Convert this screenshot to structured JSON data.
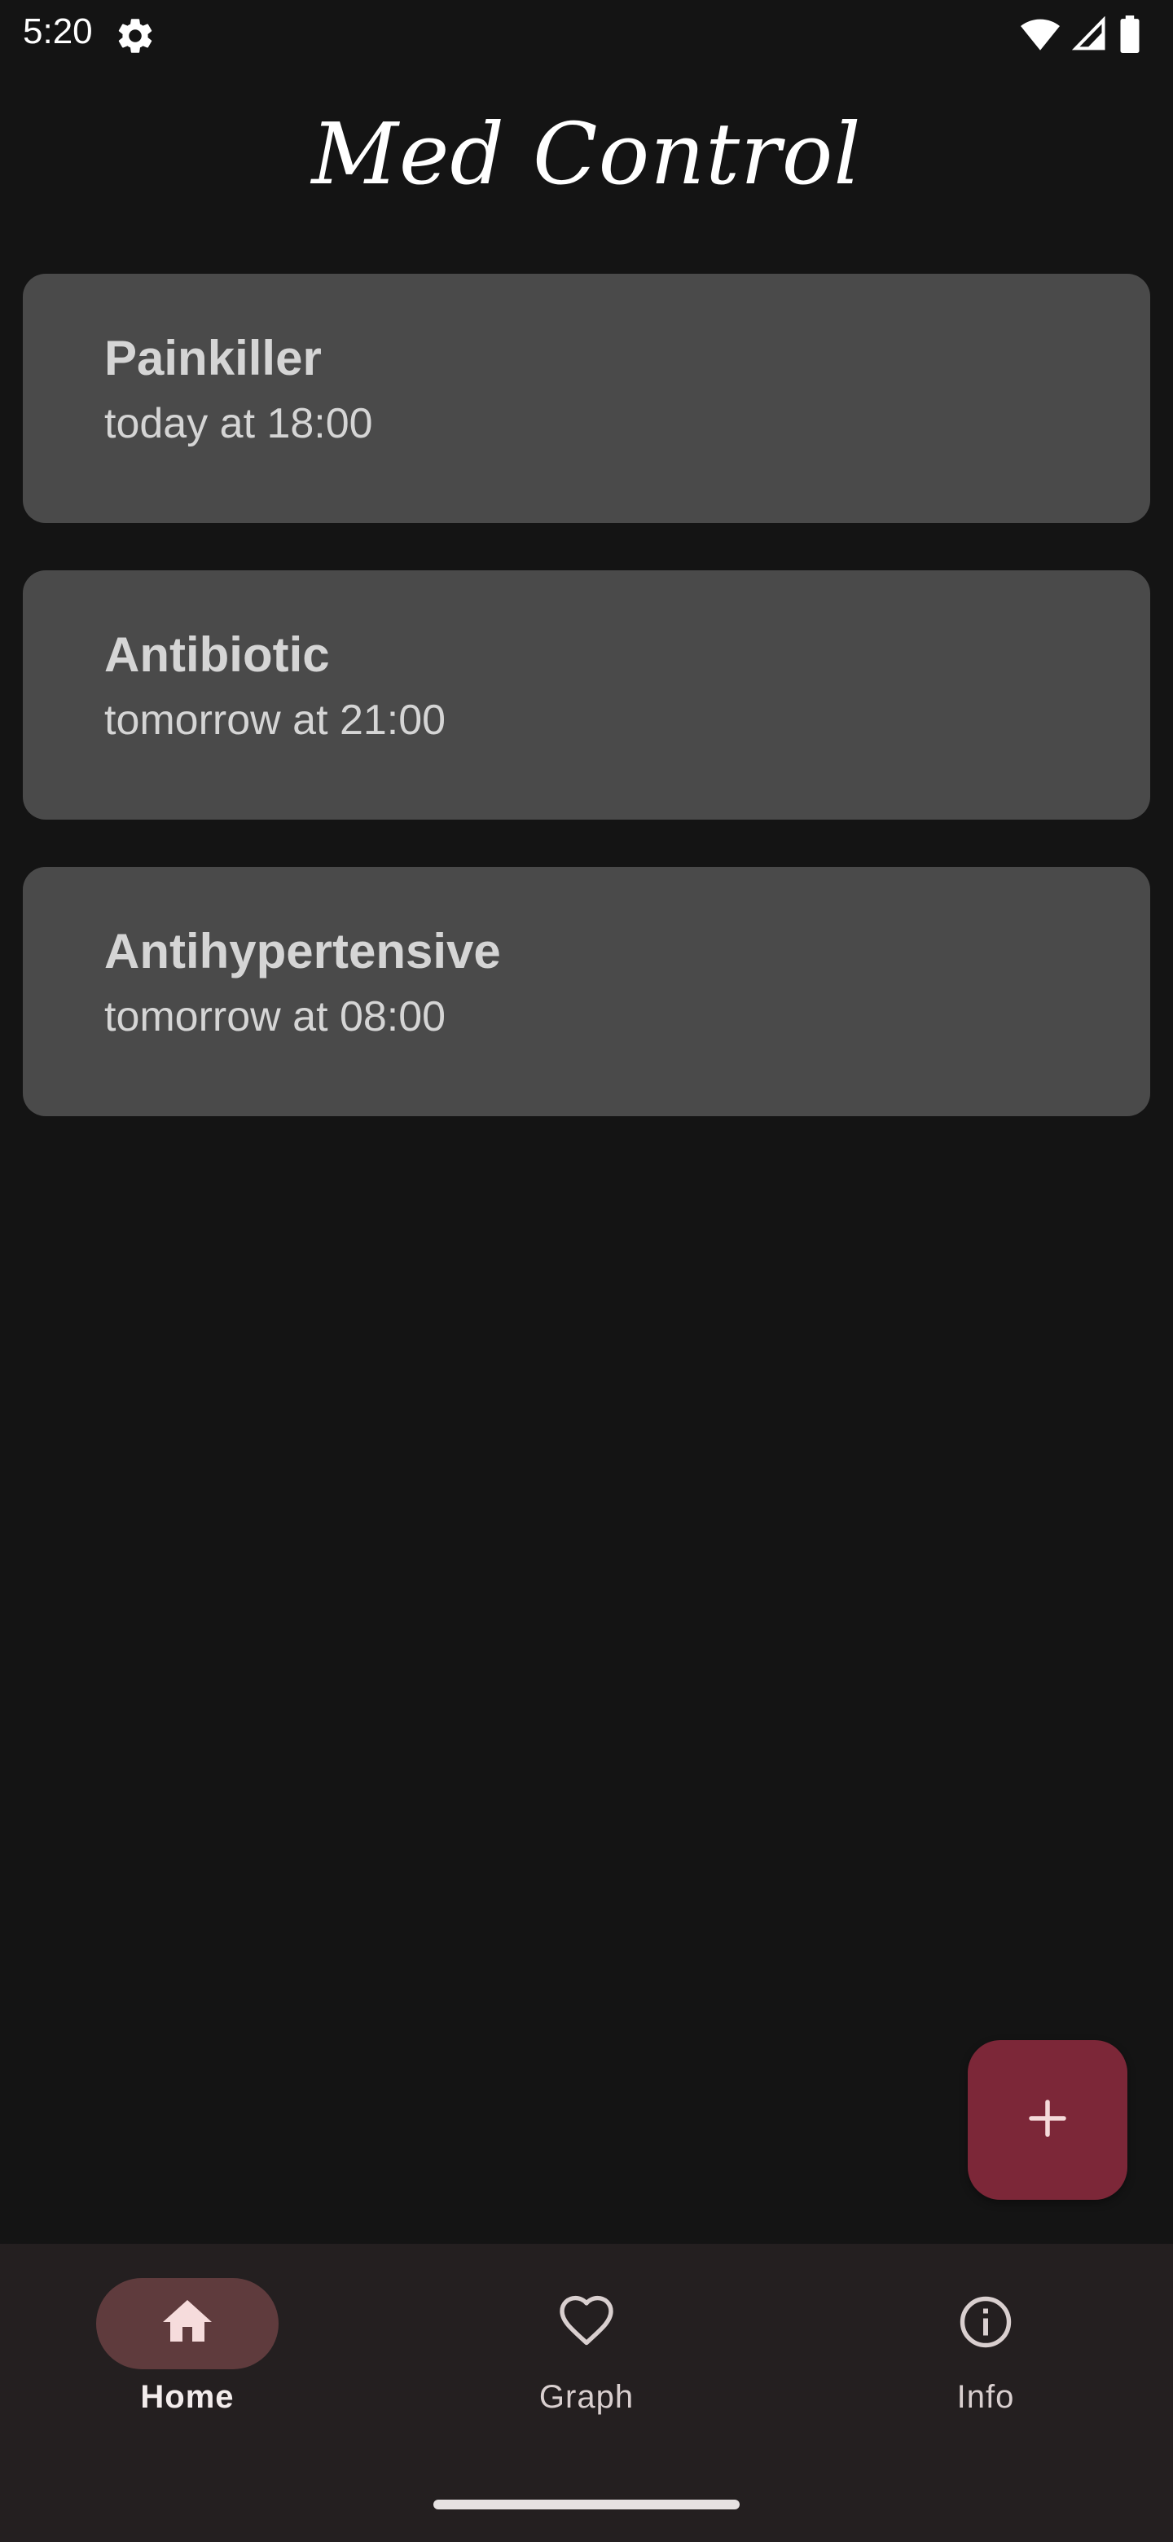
{
  "status_bar": {
    "time": "5:20",
    "icons": [
      "gear-icon",
      "wifi-icon",
      "signal-icon",
      "battery-icon"
    ]
  },
  "app": {
    "title": "Med Control"
  },
  "medications": [
    {
      "name": "Painkiller",
      "schedule": "today at 18:00"
    },
    {
      "name": "Antibiotic",
      "schedule": "tomorrow at 21:00"
    },
    {
      "name": "Antihypertensive",
      "schedule": "tomorrow at 08:00"
    }
  ],
  "fab": {
    "icon": "plus-icon"
  },
  "bottom_nav": {
    "items": [
      {
        "label": "Home",
        "icon": "home-icon",
        "active": true
      },
      {
        "label": "Graph",
        "icon": "heart-icon",
        "active": false
      },
      {
        "label": "Info",
        "icon": "info-icon",
        "active": false
      }
    ]
  },
  "colors": {
    "background": "#141414",
    "card": "#4a4a4a",
    "fab": "#7c2738",
    "nav_background": "#241f20",
    "nav_active_indicator": "#5f3b3d"
  }
}
